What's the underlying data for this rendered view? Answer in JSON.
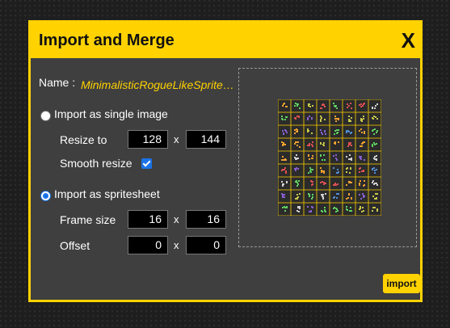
{
  "dialog": {
    "title": "Import and Merge",
    "close_label": "X"
  },
  "name": {
    "label": "Name :",
    "value": "MinimalisticRogueLikeSpritesheet…"
  },
  "single": {
    "label": "Import as single image",
    "checked": false,
    "resize_label": "Resize to",
    "width": "128",
    "height": "144",
    "x_sep": "x",
    "smooth_label": "Smooth resize",
    "smooth_checked": true
  },
  "sheet": {
    "label": "Import as spritesheet",
    "checked": true,
    "frame_label": "Frame size",
    "frame_w": "16",
    "frame_h": "16",
    "offset_label": "Offset",
    "offset_x": "0",
    "offset_y": "0",
    "x_sep": "x"
  },
  "import_label": "import",
  "colors": {
    "accent": "#ffd200",
    "panel": "#3f3f3f",
    "checkbox": "#1a73e8"
  }
}
